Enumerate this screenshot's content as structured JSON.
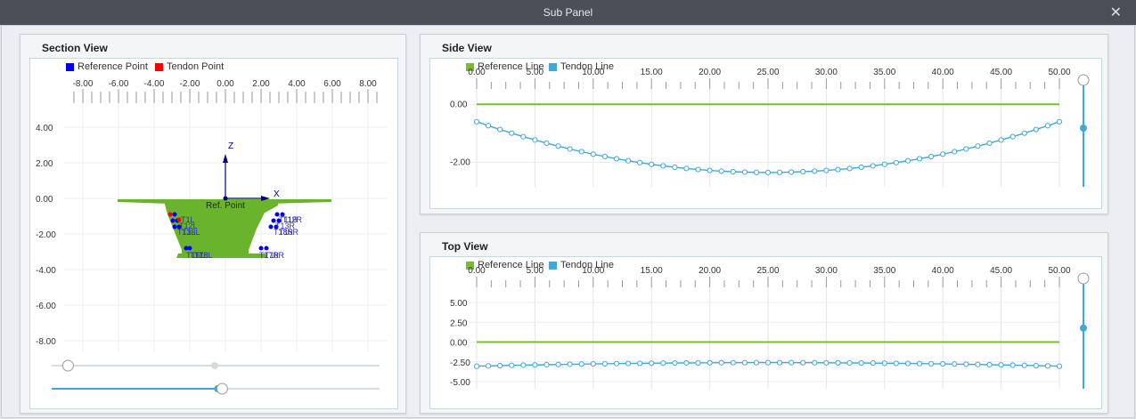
{
  "window": {
    "title": "Sub Panel",
    "close_icon": "close-icon"
  },
  "section_view": {
    "title": "Section View",
    "legend": [
      {
        "label": "Reference Point",
        "color": "#0000ff"
      },
      {
        "label": "Tendon Point",
        "color": "#ff0000"
      }
    ],
    "x_ticks": [
      "-8.00",
      "-6.00",
      "-4.00",
      "-2.00",
      "0.00",
      "2.00",
      "4.00",
      "6.00",
      "8.00"
    ],
    "y_ticks": [
      "4.00",
      "2.00",
      "0.00",
      "-2.00",
      "-4.00",
      "-6.00",
      "-8.00"
    ],
    "axis_z": "Z",
    "axis_x": "X",
    "ref_label": "Ref. Point",
    "left_tendon_labels": [
      "T1L",
      "T12L",
      "T13L",
      "T13L",
      "T16L",
      "T17L",
      "T18L"
    ],
    "right_tendon_labels": [
      "T11R",
      "T12R",
      "T13R",
      "T15R",
      "T18R",
      "T17R",
      "T18R"
    ],
    "colors": {
      "section": "#6ab42d",
      "axis": "#000080",
      "ref_point": "#0000ff",
      "tendon_point": "#ff0000"
    }
  },
  "side_view": {
    "title": "Side View",
    "legend": [
      {
        "label": "Reference Line",
        "color": "#78be2c"
      },
      {
        "label": "Tendon Line",
        "color": "#3fa9d9"
      }
    ],
    "x_ticks": [
      "0.00",
      "5.00",
      "10.00",
      "15.00",
      "20.00",
      "25.00",
      "30.00",
      "35.00",
      "40.00",
      "45.00",
      "50.00"
    ],
    "y_ticks": [
      "0.00",
      "-2.00"
    ],
    "chart_data": {
      "type": "line",
      "xlim": [
        0,
        50
      ],
      "ylim": [
        -2.6,
        0.1
      ],
      "series": [
        {
          "name": "Reference Line",
          "x": [
            0,
            50
          ],
          "y": [
            0,
            0
          ]
        },
        {
          "name": "Tendon Line",
          "type": "parabola",
          "x_start": 0,
          "x_end": 50,
          "y_end": -0.6,
          "y_mid": -2.35,
          "points": 51
        }
      ]
    }
  },
  "top_view": {
    "title": "Top View",
    "legend": [
      {
        "label": "Reference Line",
        "color": "#78be2c"
      },
      {
        "label": "Tendon Line",
        "color": "#3fa9d9"
      }
    ],
    "x_ticks": [
      "0.00",
      "5.00",
      "10.00",
      "15.00",
      "20.00",
      "25.00",
      "30.00",
      "35.00",
      "40.00",
      "45.00",
      "50.00"
    ],
    "y_ticks": [
      "5.00",
      "2.50",
      "0.00",
      "-2.50",
      "-5.00"
    ],
    "chart_data": {
      "type": "line",
      "xlim": [
        0,
        50
      ],
      "ylim": [
        -5,
        5
      ],
      "series": [
        {
          "name": "Reference Line",
          "x": [
            0,
            50
          ],
          "y": [
            0,
            0
          ]
        },
        {
          "name": "Tendon Line",
          "type": "parabola",
          "x_start": 0,
          "x_end": 50,
          "y_end": -3.05,
          "y_mid": -2.6,
          "points": 51
        }
      ]
    }
  },
  "sliders": {
    "section_h1": 0.05,
    "section_h2": 0.52,
    "side_v": 0.45,
    "top_v": 0.45
  }
}
